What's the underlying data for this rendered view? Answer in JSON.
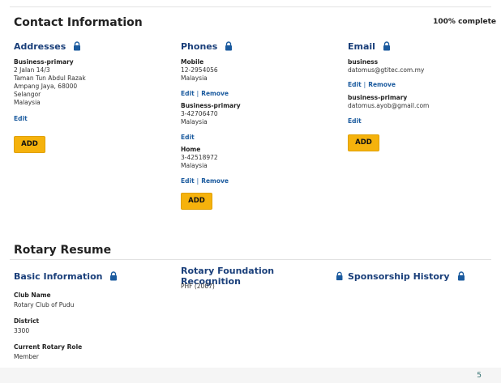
{
  "contact": {
    "title": "Contact Information",
    "complete": "100% complete",
    "addresses": {
      "heading": "Addresses",
      "label": "Business-primary",
      "lines": [
        "2 Jalan 14/3",
        "Taman Tun Abdul Razak",
        "Ampang Jaya, 68000",
        "Selangor",
        "Malaysia"
      ],
      "edit": "Edit",
      "add": "ADD"
    },
    "phones": {
      "heading": "Phones",
      "entries": [
        {
          "label": "Mobile",
          "number": "12-2954056",
          "country": "Malaysia",
          "edit": "Edit",
          "remove": "Remove"
        },
        {
          "label": "Business-primary",
          "number": "3-42706470",
          "country": "Malaysia",
          "edit": "Edit"
        },
        {
          "label": "Home",
          "number": "3-42518972",
          "country": "Malaysia",
          "edit": "Edit",
          "remove": "Remove"
        }
      ],
      "add": "ADD"
    },
    "email": {
      "heading": "Email",
      "entries": [
        {
          "label": "business",
          "address": "datomus@gtitec.com.my",
          "edit": "Edit",
          "remove": "Remove"
        },
        {
          "label": "business-primary",
          "address": "datomus.ayob@gmail.com",
          "edit": "Edit"
        }
      ],
      "add": "ADD"
    }
  },
  "resume": {
    "title": "Rotary Resume",
    "basic": {
      "heading": "Basic Information",
      "fields": [
        {
          "label": "Club Name",
          "value": "Rotary Club of Pudu"
        },
        {
          "label": "District",
          "value": "3300"
        },
        {
          "label": "Current Rotary Role",
          "value": "Member"
        }
      ]
    },
    "foundation": {
      "heading": "Rotary Foundation Recognition",
      "value": "PHF (2007)"
    },
    "sponsorship": {
      "heading": "Sponsorship History"
    }
  },
  "page_number": "5",
  "colors": {
    "accent": "#1a3f7a",
    "link": "#1a5a9e",
    "button": "#f5b20c"
  }
}
